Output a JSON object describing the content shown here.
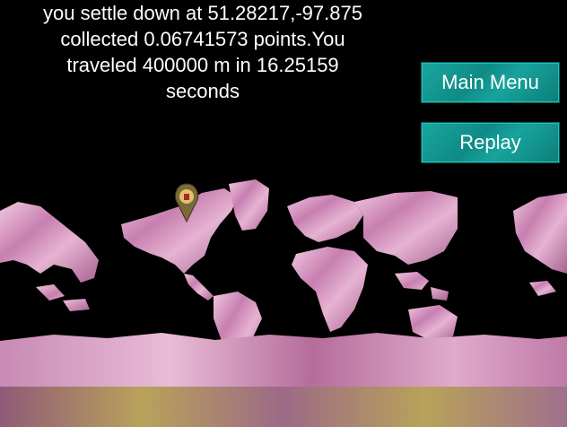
{
  "result": {
    "line1": "you settle down at 51.28217,-97.875",
    "line2": "collected 0.06741573 points.You",
    "line3": "traveled 400000 m in 16.25159",
    "line4": "seconds"
  },
  "buttons": {
    "main_menu": "Main Menu",
    "replay": "Replay"
  },
  "map": {
    "marker_icon": "map-pin-icon",
    "land_color": "#d99ac4",
    "ocean_color": "#000000",
    "band_color": "#b8a25a"
  }
}
